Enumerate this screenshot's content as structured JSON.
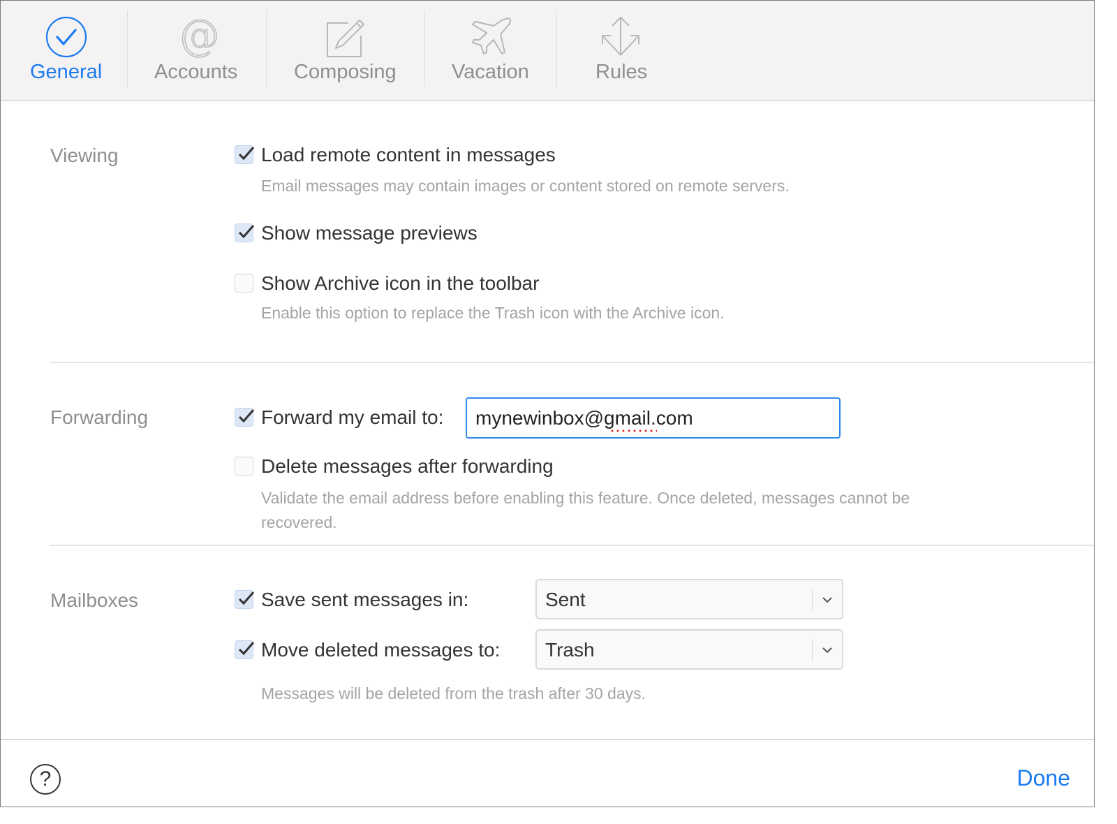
{
  "tabs": [
    {
      "id": "general",
      "label": "General",
      "icon": "checkmark-circle-icon",
      "active": true
    },
    {
      "id": "accounts",
      "label": "Accounts",
      "icon": "at-sign-icon",
      "active": false
    },
    {
      "id": "composing",
      "label": "Composing",
      "icon": "compose-pencil-icon",
      "active": false
    },
    {
      "id": "vacation",
      "label": "Vacation",
      "icon": "airplane-icon",
      "active": false
    },
    {
      "id": "rules",
      "label": "Rules",
      "icon": "rules-arrows-icon",
      "active": false
    }
  ],
  "colors": {
    "accent": "#1b7bf0",
    "toolbar_bg": "#f4f2f3",
    "section_label": "#8e8e8e",
    "hint_text": "#a4a4a4",
    "spellcheck": "#e02020"
  },
  "viewing": {
    "label": "Viewing",
    "load_remote": {
      "label": "Load remote content in messages",
      "checked": true,
      "hint": "Email messages may contain images or content stored on remote servers."
    },
    "show_previews": {
      "label": "Show message previews",
      "checked": true
    },
    "show_archive": {
      "label": "Show Archive icon in the toolbar",
      "checked": false,
      "hint": "Enable this option to replace the Trash icon with the Archive icon."
    }
  },
  "forwarding": {
    "label": "Forwarding",
    "forward": {
      "label": "Forward my email to:",
      "checked": true,
      "value": "mynewinbox@gmail.com"
    },
    "delete_after": {
      "label": "Delete messages after forwarding",
      "checked": false,
      "hint_line1": "Validate the email address before enabling this feature. Once deleted, messages cannot be",
      "hint_line2": "recovered."
    }
  },
  "mailboxes": {
    "label": "Mailboxes",
    "save_sent": {
      "label": "Save sent messages in:",
      "checked": true,
      "selected": "Sent"
    },
    "move_deleted": {
      "label": "Move deleted messages to:",
      "checked": true,
      "selected": "Trash"
    },
    "hint": "Messages will be deleted from the trash after 30 days."
  },
  "footer": {
    "help_glyph": "?",
    "done_label": "Done"
  }
}
